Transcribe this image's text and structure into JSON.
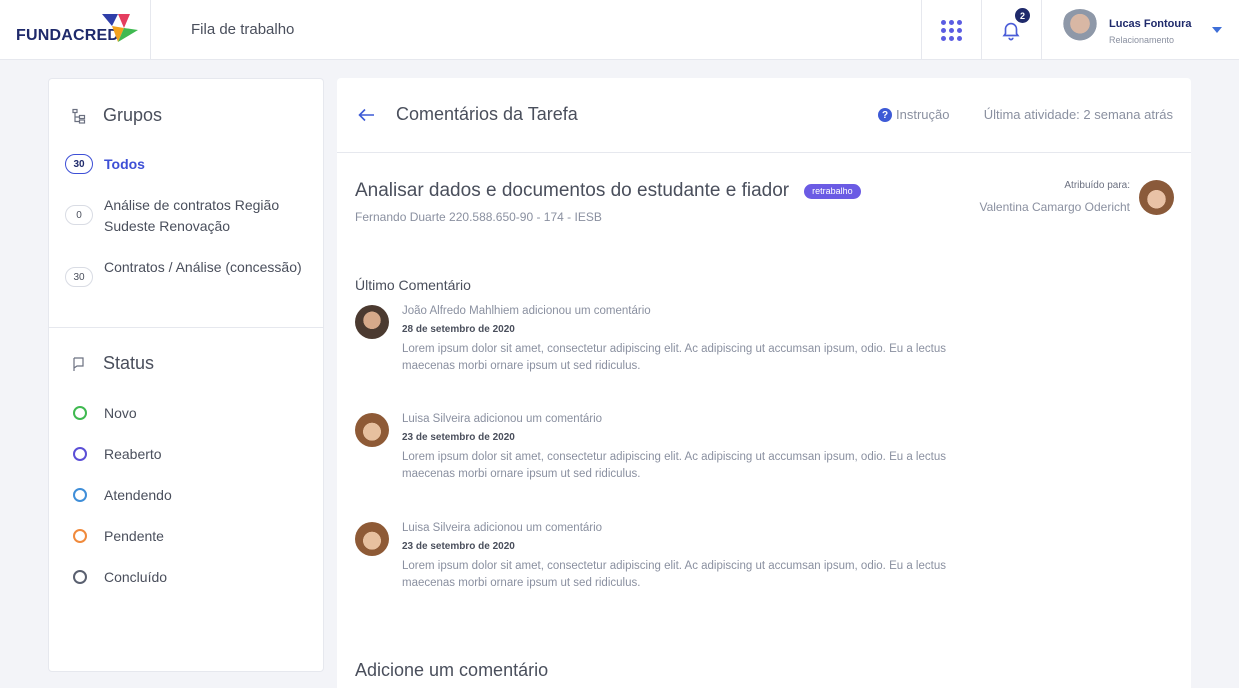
{
  "topbar": {
    "logo_text": "FUNDACRED",
    "page_title": "Fila de trabalho",
    "notifications_count": "2",
    "user": {
      "name": "Lucas Fontoura",
      "role": "Relacionamento"
    }
  },
  "sidebar": {
    "groups_title": "Grupos",
    "groups": [
      {
        "count": "30",
        "label": "Todos",
        "active": true
      },
      {
        "count": "0",
        "label": "Análise de contratos Região Sudeste Renovação",
        "active": false
      },
      {
        "count": "30",
        "label": "Contratos / Análise (concessão)",
        "active": false
      }
    ],
    "status_title": "Status",
    "statuses": [
      {
        "label": "Novo",
        "color": "#3fb950"
      },
      {
        "label": "Reaberto",
        "color": "#5b4fd6"
      },
      {
        "label": "Atendendo",
        "color": "#3f8ed8"
      },
      {
        "label": "Pendente",
        "color": "#f08a3c"
      },
      {
        "label": "Concluído",
        "color": "#5a6070"
      }
    ]
  },
  "main": {
    "header_title": "Comentários da Tarefa",
    "help_label": "Instrução",
    "last_activity": "Última atividade: 2 semana atrás",
    "task": {
      "title": "Analisar dados e documentos do estudante e fiador",
      "badge": "retrabalho",
      "subtitle": "Fernando Duarte 220.588.650-90 - 174 - IESB",
      "assigned_label": "Atribuído para:",
      "assigned_name": "Valentina Camargo Odericht"
    },
    "last_comment_title": "Último Comentário",
    "comments": [
      {
        "author": "João Alfredo Mahlhiem adicionou um comentário",
        "date": "28 de setembro de 2020",
        "text": "Lorem ipsum dolor sit amet, consectetur adipiscing elit. Ac adipiscing ut accumsan ipsum, odio. Eu a lectus maecenas morbi ornare ipsum ut sed ridiculus."
      },
      {
        "author": "Luisa Silveira adicionou um comentário",
        "date": "23 de setembro de 2020",
        "text": "Lorem ipsum dolor sit amet, consectetur adipiscing elit. Ac adipiscing ut accumsan ipsum, odio. Eu a lectus maecenas morbi ornare ipsum ut sed ridiculus."
      },
      {
        "author": "Luisa Silveira adicionou um comentário",
        "date": "23 de setembro de 2020",
        "text": "Lorem ipsum dolor sit amet, consectetur adipiscing elit. Ac adipiscing ut accumsan ipsum, odio. Eu a lectus maecenas morbi ornare ipsum ut sed ridiculus."
      }
    ],
    "add_comment_title": "Adicione um comentário"
  },
  "icons": {
    "apps": "apps-grid-icon",
    "notifications": "bell-icon",
    "user_menu": "caret-down-icon",
    "back": "arrow-left-icon",
    "help": "question-circle-icon",
    "groups": "hierarchy-icon",
    "status": "flag-icon"
  },
  "colors": {
    "brand": "#1f2a6b",
    "accent": "#3d4fd6",
    "badge": "#6b5be4"
  }
}
